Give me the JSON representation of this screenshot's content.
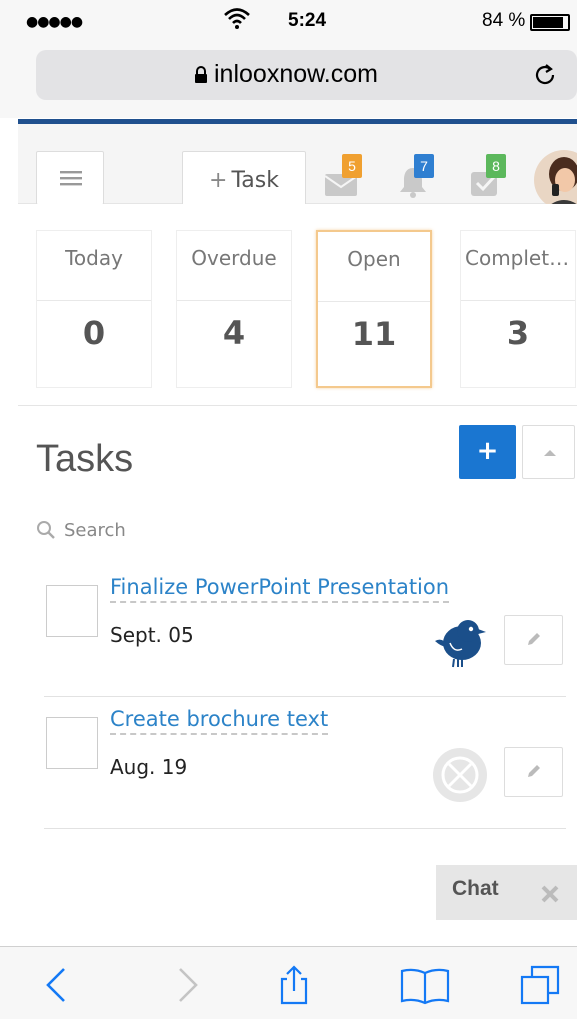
{
  "status_bar": {
    "signal": "●●●●●",
    "time": "5:24",
    "battery_percent": "84 %",
    "battery_level": 0.84
  },
  "browser": {
    "url": "inlooxnow.com"
  },
  "toolbar": {
    "task_button_label": "Task",
    "notifications": [
      {
        "icon": "mail-icon",
        "count": "5",
        "color": "#f0a030"
      },
      {
        "icon": "bell-icon",
        "count": "7",
        "color": "#2f7fd1"
      },
      {
        "icon": "task-check-icon",
        "count": "8",
        "color": "#5cb85c"
      }
    ]
  },
  "stats": [
    {
      "label": "Today",
      "count": "0"
    },
    {
      "label": "Overdue",
      "count": "4"
    },
    {
      "label": "Open",
      "count": "11",
      "active": true
    },
    {
      "label": "Completed",
      "count": "3"
    }
  ],
  "tasks_section": {
    "title": "Tasks",
    "add_label": "+",
    "search_placeholder": "Search",
    "items": [
      {
        "title": "Finalize PowerPoint Presentation",
        "date": "Sept. 05",
        "assignee_icon": "bird-avatar-icon"
      },
      {
        "title": "Create brochure text",
        "date": "Aug. 19",
        "assignee_icon": "unassigned-icon"
      }
    ]
  },
  "chat": {
    "label": "Chat"
  },
  "colors": {
    "brand": "#20508e",
    "accent_blue": "#1a76d1",
    "link": "#2c83c8",
    "active_tile_border": "#f4c98d"
  }
}
